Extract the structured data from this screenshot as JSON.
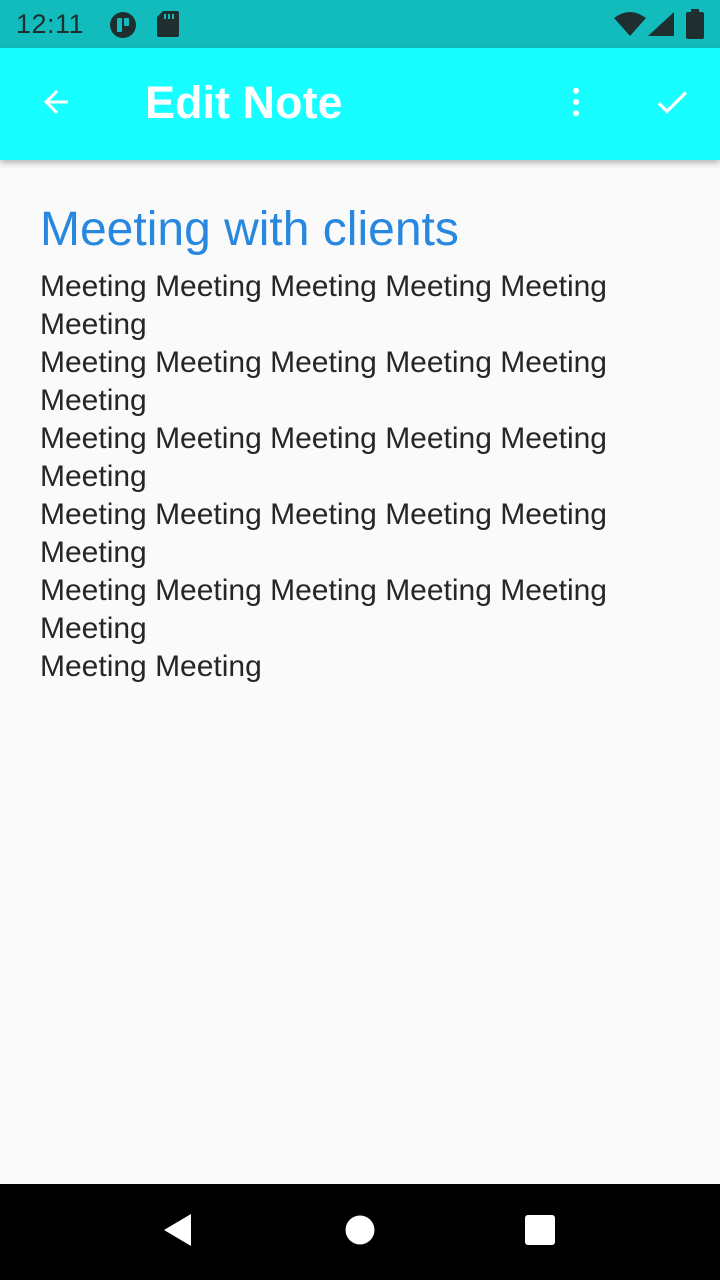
{
  "status_bar": {
    "time": "12:11",
    "icons": [
      "app-notification-icon",
      "sd-card-icon",
      "wifi-icon",
      "cell-signal-icon",
      "battery-icon"
    ]
  },
  "app_bar": {
    "title": "Edit Note",
    "back_icon": "arrow-back-icon",
    "menu_icon": "more-vert-icon",
    "save_icon": "check-icon",
    "color": "#16feff"
  },
  "note": {
    "title": "Meeting with clients",
    "body": "Meeting Meeting Meeting Meeting Meeting Meeting\nMeeting Meeting Meeting Meeting Meeting Meeting\nMeeting Meeting Meeting Meeting Meeting Meeting\nMeeting Meeting Meeting Meeting Meeting Meeting\nMeeting Meeting Meeting Meeting Meeting Meeting\nMeeting Meeting",
    "title_color": "#2887de"
  },
  "nav_bar": {
    "back_icon": "nav-back-triangle-icon",
    "home_icon": "nav-home-circle-icon",
    "recents_icon": "nav-recents-square-icon"
  }
}
